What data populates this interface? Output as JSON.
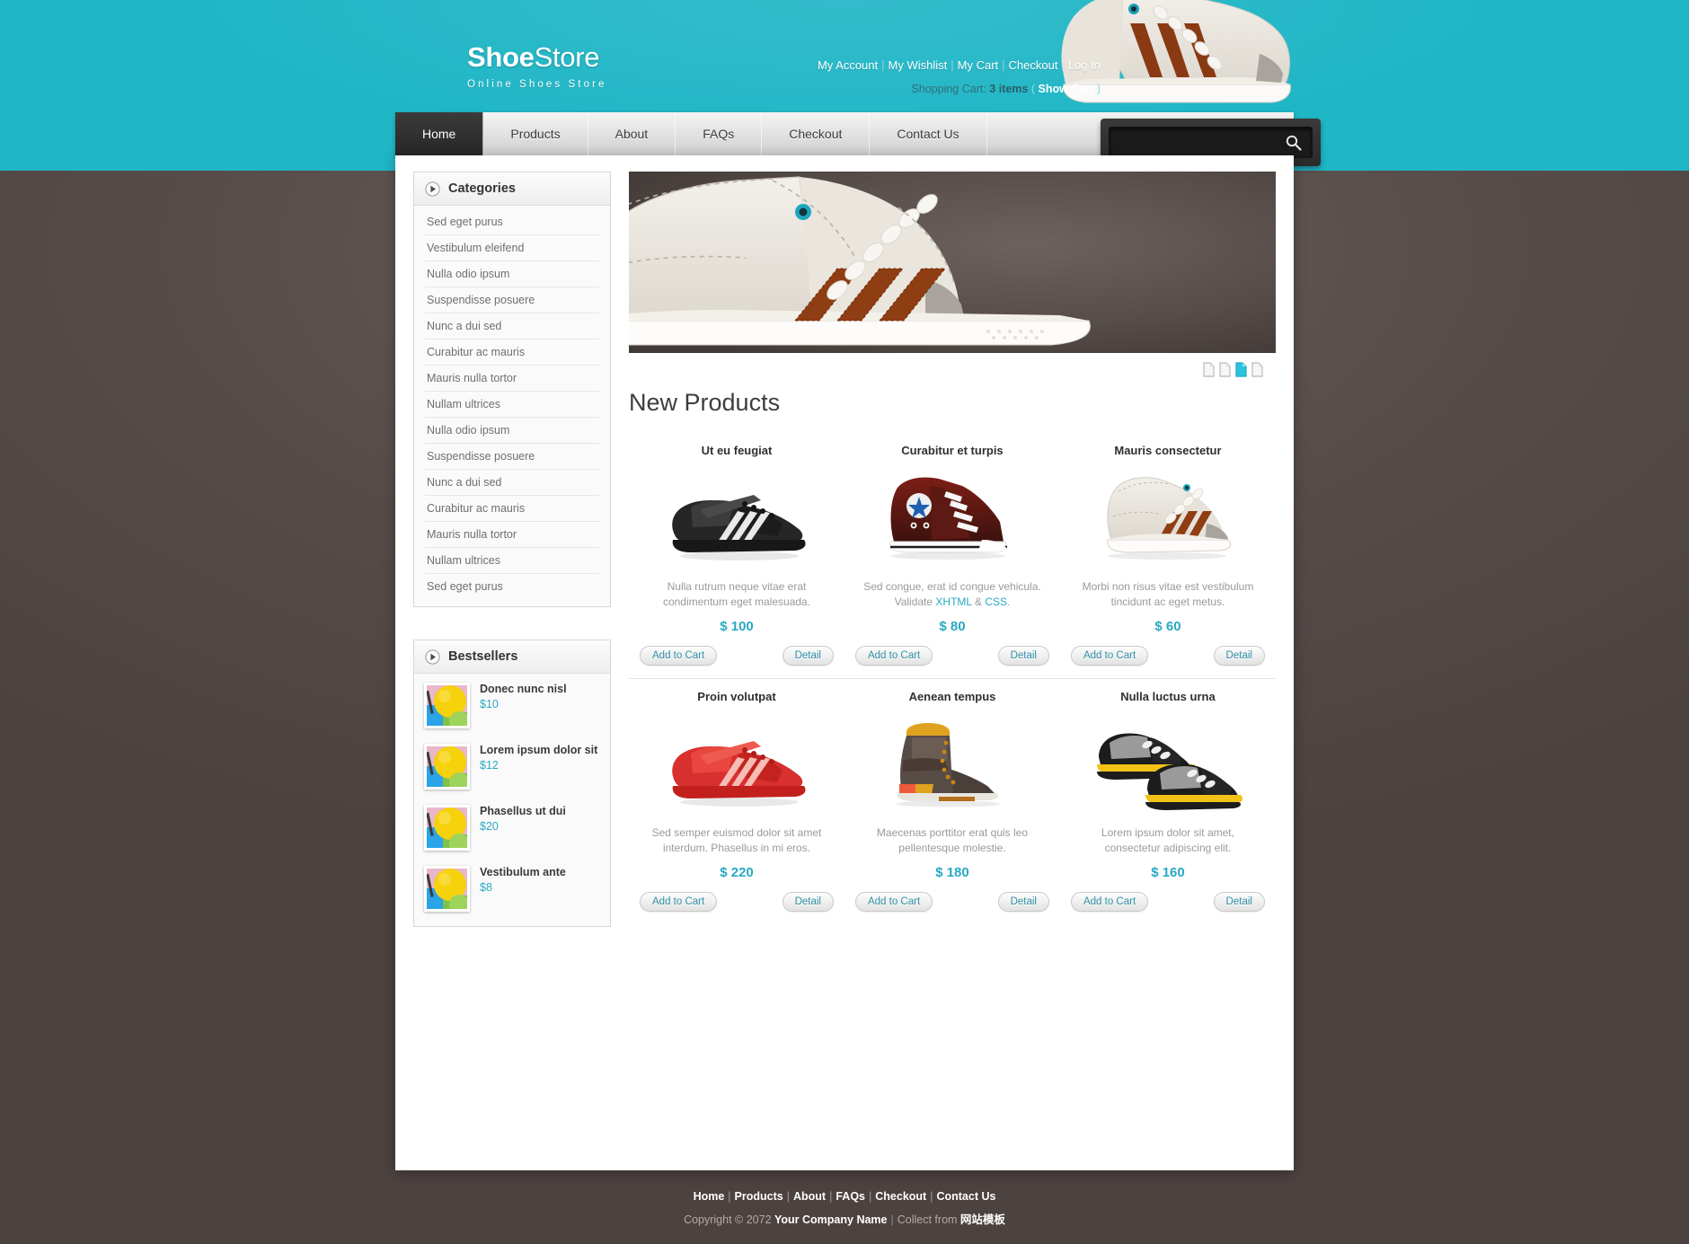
{
  "header": {
    "logo_main_bold": "Shoe",
    "logo_main_light": "Store",
    "logo_sub": "Online Shoes Store",
    "account_links": [
      "My Account",
      "My Wishlist",
      "My Cart",
      "Checkout",
      "Log In"
    ],
    "cart_label": "Shopping Cart:",
    "cart_items": "3 items",
    "cart_show": "Show Cart",
    "paren_open": "(",
    "paren_close": ")"
  },
  "nav": {
    "items": [
      "Home",
      "Products",
      "About",
      "FAQs",
      "Checkout",
      "Contact Us"
    ],
    "active": "Home"
  },
  "search": {
    "value": "",
    "placeholder": "",
    "icon": "search-icon"
  },
  "sidebar": {
    "categories": {
      "title": "Categories",
      "icon": "play-icon",
      "items": [
        "Sed eget purus",
        "Vestibulum eleifend",
        "Nulla odio ipsum",
        "Suspendisse posuere",
        "Nunc a dui sed",
        "Curabitur ac mauris",
        "Mauris nulla tortor",
        "Nullam ultrices",
        "Nulla odio ipsum",
        "Suspendisse posuere",
        "Nunc a dui sed",
        "Curabitur ac mauris",
        "Mauris nulla tortor",
        "Nullam ultrices",
        "Sed eget purus"
      ]
    },
    "bestsellers": {
      "title": "Bestsellers",
      "icon": "play-icon",
      "items": [
        {
          "name": "Donec nunc nisl",
          "price": "$10"
        },
        {
          "name": "Lorem ipsum dolor sit",
          "price": "$12"
        },
        {
          "name": "Phasellus ut dui",
          "price": "$20"
        },
        {
          "name": "Vestibulum ante",
          "price": "$8"
        }
      ]
    }
  },
  "banner": {
    "pages": 4,
    "active_page": 3
  },
  "main": {
    "section_title": "New Products",
    "add_to_cart_label": "Add to Cart",
    "detail_label": "Detail",
    "products": [
      {
        "title": "Ut eu feugiat",
        "desc": "Nulla rutrum neque vitae erat condimentum eget malesuada.",
        "price": "$ 100",
        "image": "black-sneaker"
      },
      {
        "title": "Curabitur et turpis",
        "desc_pre": "Sed congue, erat id congue vehicula. Validate ",
        "desc_link1": "XHTML",
        "desc_mid": " & ",
        "desc_link2": "CSS",
        "desc_post": ".",
        "desc": "Sed congue, erat id congue vehicula. Validate XHTML & CSS.",
        "price": "$ 80",
        "image": "maroon-hightop"
      },
      {
        "title": "Mauris consectetur",
        "desc": "Morbi non risus vitae est vestibulum tincidunt ac eget metus.",
        "price": "$ 60",
        "image": "cream-hightop"
      },
      {
        "title": "Proin volutpat",
        "desc": "Sed semper euismod dolor sit amet interdum. Phasellus in mi eros.",
        "price": "$ 220",
        "image": "red-sneaker"
      },
      {
        "title": "Aenean tempus",
        "desc": "Maecenas porttitor erat quis leo pellentesque molestie.",
        "price": "$ 180",
        "image": "brown-boot"
      },
      {
        "title": "Nulla luctus urna",
        "desc": "Lorem ipsum dolor sit amet, consectetur adipiscing elit.",
        "price": "$ 160",
        "image": "grey-yellow-pair"
      }
    ]
  },
  "footer": {
    "links": [
      "Home",
      "Products",
      "About",
      "FAQs",
      "Checkout",
      "Contact Us"
    ],
    "copyright_pre": "Copyright © 2072 ",
    "company": "Your Company Name",
    "collect_label": "Collect from ",
    "collect_link": "网站模板"
  },
  "colors": {
    "teal": "#1fb6c6",
    "accent_price": "#29a8c4",
    "dark_nav": "#2d2d2d",
    "page_bg": "#554b49"
  }
}
